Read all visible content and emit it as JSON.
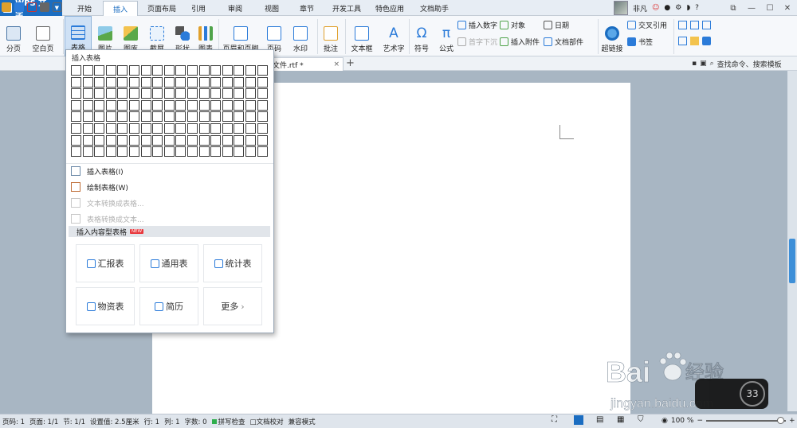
{
  "app": {
    "name": "WPS 文字"
  },
  "menu_tabs": [
    "开始",
    "插入",
    "页面布局",
    "引用",
    "审阅",
    "视图",
    "章节",
    "开发工具",
    "特色应用",
    "文档助手"
  ],
  "active_tab": "插入",
  "user": {
    "name": "非凡"
  },
  "window_controls": {
    "minimize": "—",
    "maximize": "☐",
    "close": "✕",
    "help": "?"
  },
  "ribbon": {
    "page_break": "分页",
    "blank_page": "空白页",
    "table": "表格",
    "picture": "图片",
    "gallery": "图库",
    "screenshot": "截屏",
    "shapes": "形状",
    "chart": "图表",
    "header_footer": "页眉和页脚",
    "page_number": "页码",
    "watermark": "水印",
    "comment": "批注",
    "textbox": "文本框",
    "wordart": "艺术字",
    "symbol": "符号",
    "formula": "公式",
    "insert_number": "插入数字",
    "object": "对象",
    "date": "日期",
    "drop_cap": "首字下沉",
    "insert_attachment": "插入附件",
    "doc_parts": "文档部件",
    "hyperlink": "超链接",
    "cross_ref": "交叉引用",
    "bookmark": "书签"
  },
  "doc_tab": {
    "title": "文件.rtf *",
    "close": "×",
    "add": "+"
  },
  "search": {
    "label": "查找命令、搜索模板"
  },
  "dropdown": {
    "title": "插入表格",
    "grid": {
      "rows": 8,
      "cols": 17
    },
    "items": [
      {
        "label": "插入表格(I)",
        "disabled": false
      },
      {
        "label": "绘制表格(W)",
        "disabled": false
      },
      {
        "label": "文本转换成表格...",
        "disabled": true
      },
      {
        "label": "表格转换成文本...",
        "disabled": true
      }
    ],
    "content_header": "插入内容型表格",
    "new_badge": "NEW",
    "cards": [
      "汇报表",
      "通用表",
      "统计表",
      "物资表",
      "简历",
      "更多"
    ],
    "more_arrow": "›"
  },
  "status": {
    "page": "页码: 1",
    "pages": "页面: 1/1",
    "section": "节: 1/1",
    "setting": "设置值: 2.5厘米",
    "row": "行: 1",
    "col": "列: 1",
    "words": "字数: 0",
    "spell": "拼写检查",
    "proof": "文档校对",
    "compat": "兼容模式"
  },
  "zoom": {
    "percent": "100 %",
    "minus": "−",
    "plus": "+",
    "level": 0.94
  },
  "watermark": {
    "brand": "Bai",
    "brand2": "经验",
    "url": "jingyan.baidu.com"
  },
  "widget": {
    "speed": "33"
  },
  "colors": {
    "accent": "#1b6dc1",
    "ribbon_bg": "#f6f8fb",
    "canvas": "#a8b6c3"
  }
}
